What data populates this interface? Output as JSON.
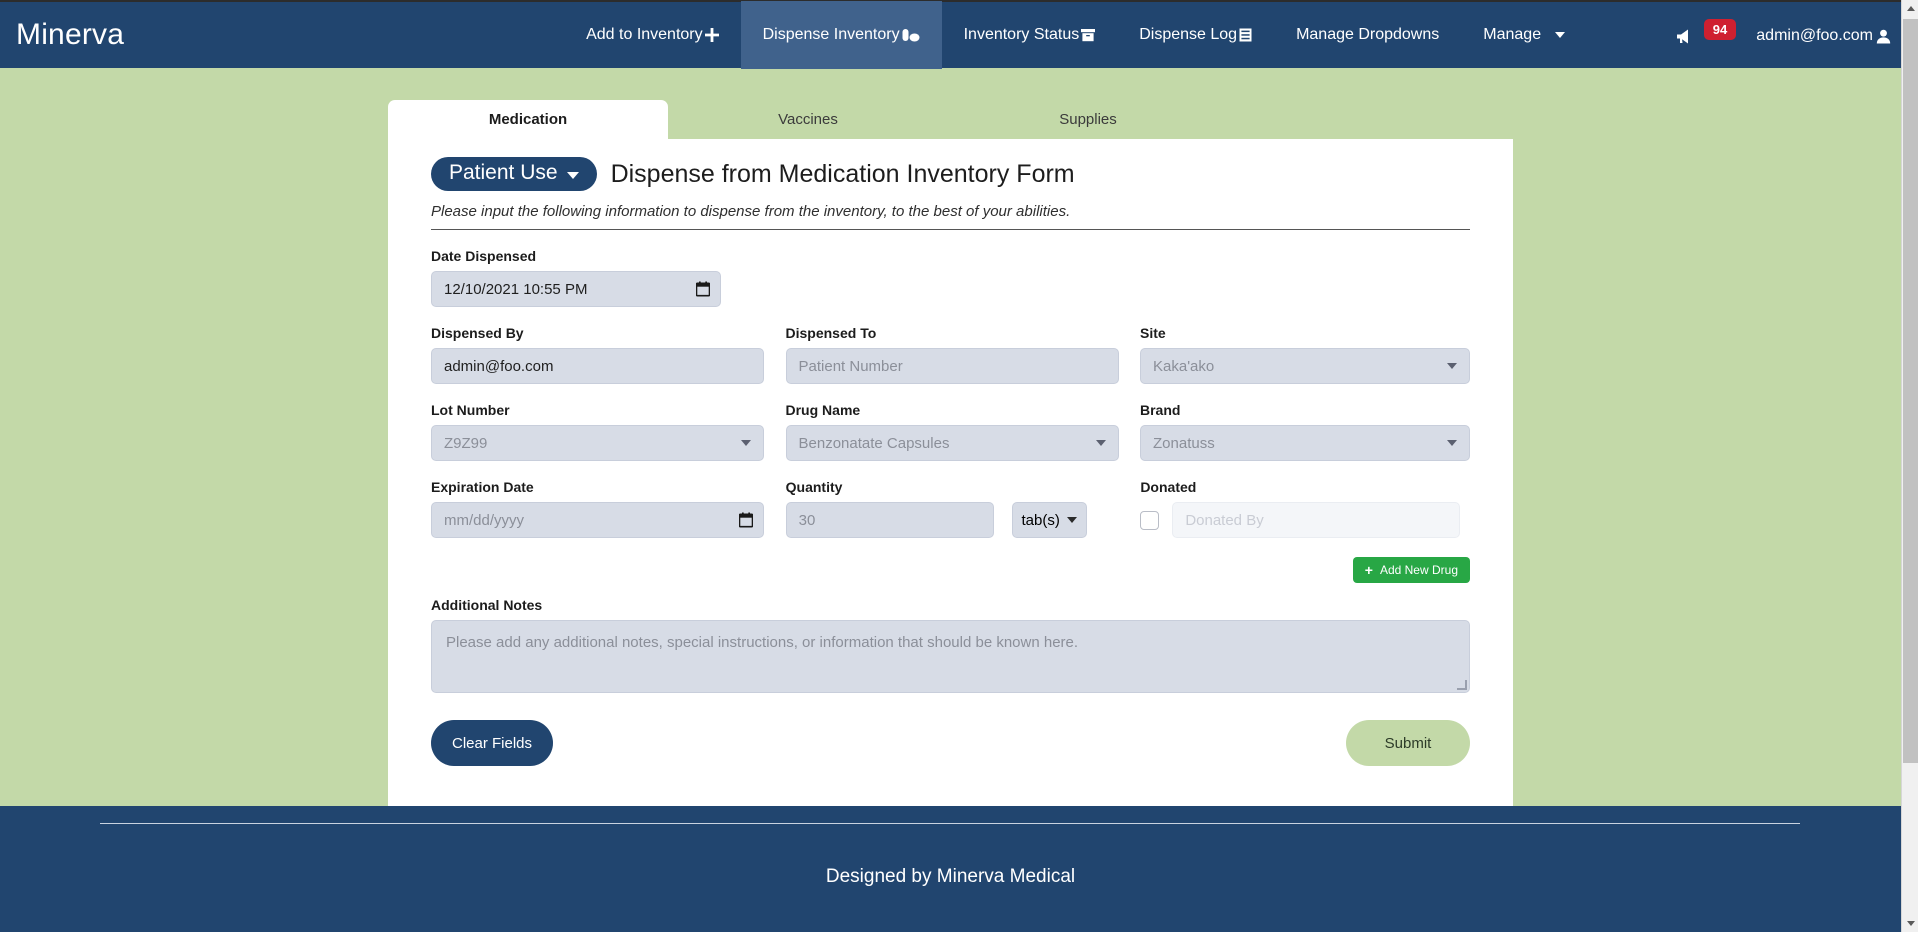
{
  "navbar": {
    "brand": "Minerva",
    "items": [
      {
        "label": "Add to Inventory",
        "icon": "plus-icon",
        "active": false
      },
      {
        "label": "Dispense Inventory",
        "icon": "pill-capsule-icon",
        "active": true
      },
      {
        "label": "Inventory Status",
        "icon": "box-icon",
        "active": false
      },
      {
        "label": "Dispense Log",
        "icon": "list-icon",
        "active": false
      },
      {
        "label": "Manage Dropdowns",
        "icon": "",
        "active": false
      },
      {
        "label": "Manage",
        "icon": "chevron-down-icon",
        "active": false
      }
    ],
    "announcement_icon": "megaphone-icon",
    "announcement_count": "94",
    "user_email": "admin@foo.com",
    "user_icon": "user-icon"
  },
  "tabs": [
    {
      "label": "Medication",
      "active": true
    },
    {
      "label": "Vaccines",
      "active": false
    },
    {
      "label": "Supplies",
      "active": false
    }
  ],
  "form": {
    "use_pill": "Patient Use",
    "title": "Dispense from Medication Inventory Form",
    "subtitle": "Please input the following information to dispense from the inventory, to the best of your abilities.",
    "fields": {
      "date_dispensed": {
        "label": "Date Dispensed",
        "value": "12/10/2021 10:55 PM",
        "icon": "calendar-icon"
      },
      "dispensed_by": {
        "label": "Dispensed By",
        "value": "admin@foo.com"
      },
      "dispensed_to": {
        "label": "Dispensed To",
        "placeholder": "Patient Number"
      },
      "site": {
        "label": "Site",
        "placeholder": "Kaka'ako",
        "icon": "chevron-down-icon"
      },
      "lot_number": {
        "label": "Lot Number",
        "placeholder": "Z9Z99",
        "icon": "chevron-down-icon"
      },
      "drug_name": {
        "label": "Drug Name",
        "placeholder": "Benzonatate Capsules",
        "icon": "chevron-down-icon"
      },
      "brand": {
        "label": "Brand",
        "placeholder": "Zonatuss",
        "icon": "chevron-down-icon"
      },
      "expiration_date": {
        "label": "Expiration Date",
        "placeholder": "mm/dd/yyyy",
        "icon": "calendar-icon"
      },
      "quantity": {
        "label": "Quantity",
        "placeholder": "30"
      },
      "unit": {
        "value": "tab(s)",
        "icon": "chevron-down-icon"
      },
      "donated": {
        "label": "Donated",
        "checkbox": "donated-checkbox",
        "placeholder": "Donated By"
      },
      "additional_notes": {
        "label": "Additional Notes",
        "placeholder": "Please add any additional notes, special instructions, or information that should be known here."
      }
    },
    "add_new_drug": {
      "label": "Add New Drug",
      "icon": "plus-icon"
    },
    "clear_button": "Clear Fields",
    "submit_button": "Submit"
  },
  "footer": {
    "text": "Designed by Minerva Medical"
  },
  "colors": {
    "navy": "#21456f",
    "page_green": "#c3d9a8",
    "field_gray": "#d7dce6",
    "accent_green": "#28a745",
    "badge_red": "#cf2030"
  }
}
